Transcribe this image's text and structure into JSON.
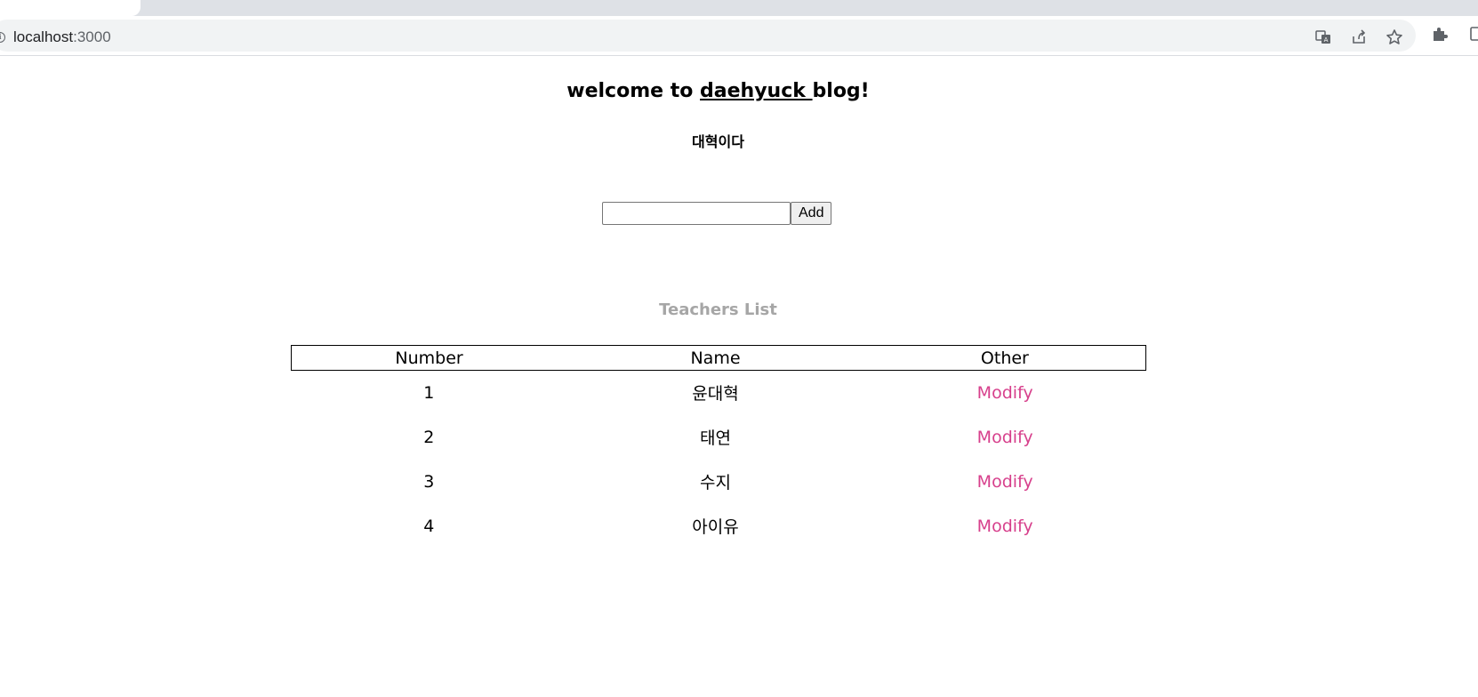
{
  "browser": {
    "url_host": "localhost",
    "url_port": ":3000",
    "icons": [
      "info-icon",
      "translate-icon",
      "share-icon",
      "bookmark-star-icon",
      "extensions-icon",
      "side-panel-icon"
    ]
  },
  "page": {
    "welcome_prefix": "welcome to ",
    "welcome_name": "daehyuck ",
    "welcome_suffix": "blog!",
    "subtitle": "대혁이다",
    "add_form": {
      "input_value": "",
      "button_label": "Add"
    },
    "list_title": "Teachers List",
    "table": {
      "headers": [
        "Number",
        "Name",
        "Other"
      ],
      "rows": [
        {
          "number": "1",
          "name": "윤대혁",
          "other": "Modify"
        },
        {
          "number": "2",
          "name": "태연",
          "other": "Modify"
        },
        {
          "number": "3",
          "name": "수지",
          "other": "Modify"
        },
        {
          "number": "4",
          "name": "아이유",
          "other": "Modify"
        }
      ]
    },
    "colors": {
      "modify_link": "#d7408c",
      "list_title": "#a6a6a6"
    }
  }
}
